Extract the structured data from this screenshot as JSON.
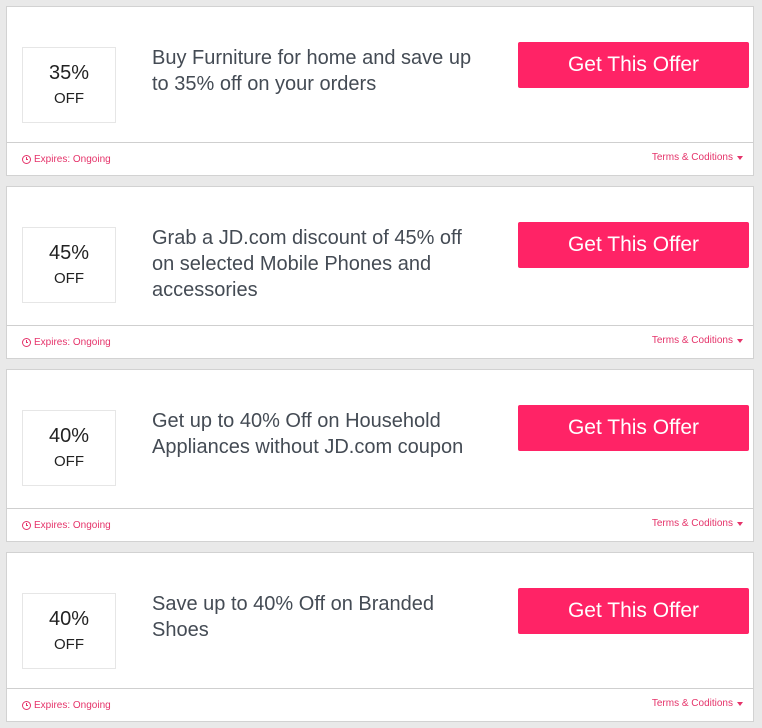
{
  "theme": {
    "accent": "#ff2366",
    "footer_text": "#e5336a",
    "title_text": "#444b54"
  },
  "offers": [
    {
      "discount_value": "35%",
      "discount_unit": "OFF",
      "title": "Buy Furniture for home and save up to 35% off on your orders",
      "button_label": "Get This Offer",
      "expires": "Expires: Ongoing",
      "terms_label": "Terms & Coditions"
    },
    {
      "discount_value": "45%",
      "discount_unit": "OFF",
      "title": "Grab a JD.com discount of 45% off on selected Mobile Phones and accessories",
      "button_label": "Get This Offer",
      "expires": "Expires: Ongoing",
      "terms_label": "Terms & Coditions"
    },
    {
      "discount_value": "40%",
      "discount_unit": "OFF",
      "title": "Get up to 40% Off on Household Appliances without JD.com coupon",
      "button_label": "Get This Offer",
      "expires": "Expires: Ongoing",
      "terms_label": "Terms & Coditions"
    },
    {
      "discount_value": "40%",
      "discount_unit": "OFF",
      "title": "Save up to 40% Off on Branded Shoes",
      "button_label": "Get This Offer",
      "expires": "Expires: Ongoing",
      "terms_label": "Terms & Coditions"
    }
  ]
}
